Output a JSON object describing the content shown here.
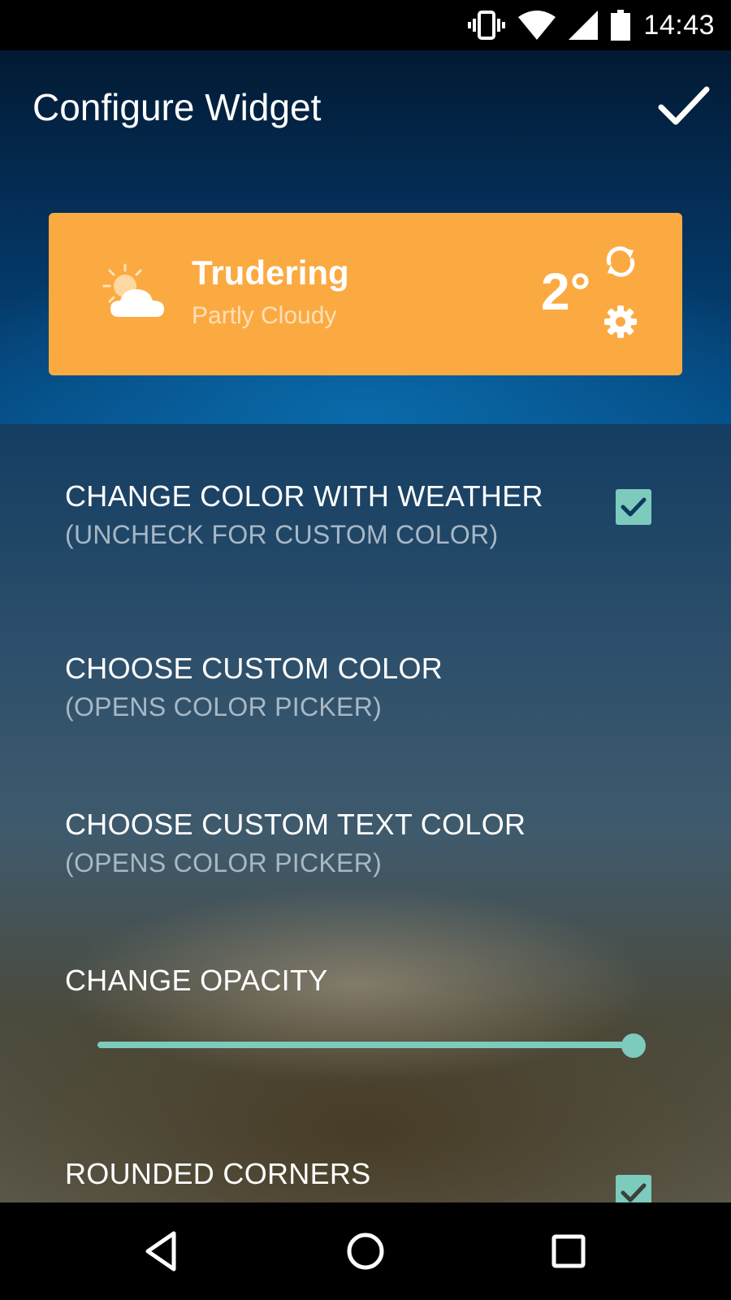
{
  "status_bar": {
    "time": "14:43",
    "icons": [
      "vibrate-icon",
      "wifi-icon",
      "signal-icon",
      "battery-icon"
    ]
  },
  "header": {
    "title": "Configure Widget",
    "confirm_icon": "check-icon"
  },
  "widget_preview": {
    "city": "Trudering",
    "condition": "Partly Cloudy",
    "temperature": "2°",
    "weather_icon": "partly-cloudy-icon",
    "actions": [
      "refresh-icon",
      "settings-icon"
    ],
    "background_color": "#fbaa42"
  },
  "settings": [
    {
      "title": "CHANGE COLOR WITH WEATHER",
      "subtitle": "(UNCHECK FOR CUSTOM COLOR)",
      "checked": true
    },
    {
      "title": "CHOOSE CUSTOM COLOR",
      "subtitle": "(OPENS COLOR PICKER)"
    },
    {
      "title": "CHOOSE CUSTOM TEXT COLOR",
      "subtitle": "(OPENS COLOR PICKER)"
    },
    {
      "title": "CHANGE OPACITY",
      "slider_value": 1.0
    },
    {
      "title": "ROUNDED CORNERS",
      "checked": true
    }
  ],
  "accent_color": "#7ccbbd",
  "nav_bar": [
    "back-icon",
    "home-icon",
    "recents-icon"
  ]
}
